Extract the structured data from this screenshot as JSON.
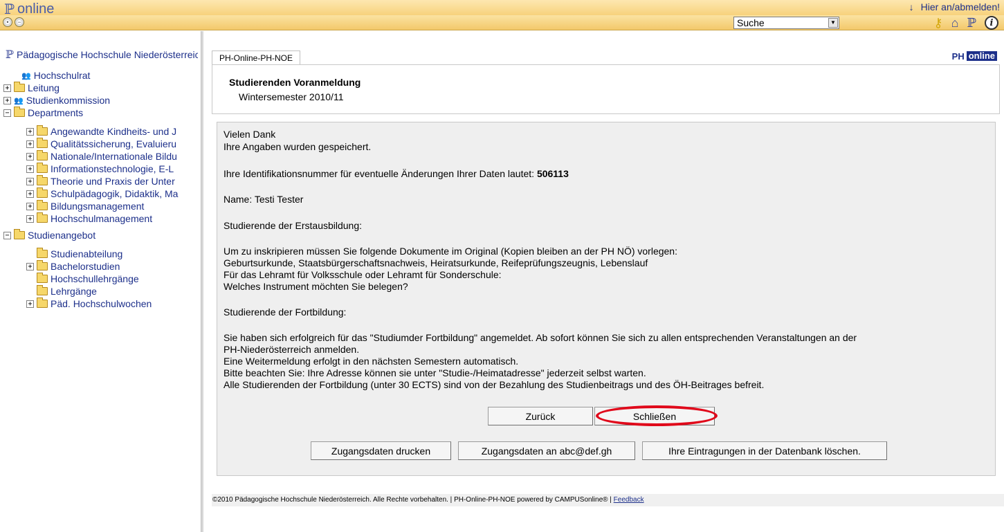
{
  "header": {
    "brand_text": "online",
    "login_text": "Hier an/abmelden!",
    "search_value": "Suche"
  },
  "toolbar": {
    "icons": [
      "back-icon",
      "forward-icon",
      "key-icon",
      "home-icon",
      "ph-icon",
      "info-icon"
    ]
  },
  "sidebar": {
    "root_label": "Pädagogische Hochschule Niederösterreich",
    "items": [
      {
        "label": "Hochschulrat",
        "icon": "people-icon",
        "expander": ""
      },
      {
        "label": "Leitung",
        "icon": "folder-icon",
        "expander": "+"
      },
      {
        "label": "Studienkommission",
        "icon": "people-icon",
        "expander": "+"
      },
      {
        "label": "Departments",
        "icon": "folder-icon",
        "expander": "−"
      },
      {
        "label": "Angewandte Kindheits- und J",
        "icon": "folder-icon",
        "expander": "+"
      },
      {
        "label": "Qualitätssicherung, Evaluieru",
        "icon": "folder-icon",
        "expander": "+"
      },
      {
        "label": "Nationale/Internationale Bildu",
        "icon": "folder-icon",
        "expander": "+"
      },
      {
        "label": "Informationstechnologie, E-L",
        "icon": "folder-icon",
        "expander": "+"
      },
      {
        "label": "Theorie und Praxis der Unter",
        "icon": "folder-icon",
        "expander": "+"
      },
      {
        "label": "Schulpädagogik, Didaktik, Ma",
        "icon": "folder-icon",
        "expander": "+"
      },
      {
        "label": "Bildungsmanagement",
        "icon": "folder-icon",
        "expander": "+"
      },
      {
        "label": "Hochschulmanagement",
        "icon": "folder-icon",
        "expander": "+"
      },
      {
        "label": "Studienangebot",
        "icon": "folder-icon",
        "expander": "−"
      },
      {
        "label": "Studienabteilung",
        "icon": "folder-icon",
        "expander": ""
      },
      {
        "label": "Bachelorstudien",
        "icon": "folder-icon",
        "expander": "+"
      },
      {
        "label": "Hochschullehrgänge",
        "icon": "folder-icon",
        "expander": ""
      },
      {
        "label": "Lehrgänge",
        "icon": "folder-icon",
        "expander": ""
      },
      {
        "label": "Päd. Hochschulwochen",
        "icon": "folder-icon",
        "expander": "+"
      }
    ]
  },
  "main": {
    "tab_label": "PH-Online-PH-NOE",
    "logo_ph": "PH",
    "logo_online": "online",
    "title": "Studierenden Voranmeldung",
    "subtitle": "Wintersemester 2010/11",
    "lines": {
      "l1": "Vielen Dank",
      "l2": "Ihre Angaben wurden gespeichert.",
      "l3_prefix": "Ihre Identifikationsnummer für eventuelle Änderungen Ihrer Daten lautet: ",
      "l3_id": "506113",
      "l4": "Name: Testi Tester",
      "l5": "Studierende der Erstausbildung:",
      "l6": "Um zu inskripieren müssen Sie folgende Dokumente im Original (Kopien bleiben an der PH NÖ) vorlegen:",
      "l7": "Geburtsurkunde, Staatsbürgerschaftsnachweis, Heiratsurkunde, Reifeprüfungszeugnis, Lebenslauf",
      "l8": "Für das Lehramt für Volksschule oder Lehramt für Sonderschule:",
      "l9": "Welches Instrument möchten Sie belegen?",
      "l10": "Studierende der Fortbildung:",
      "l11": "Sie haben sich erfolgreich für das \"Studiumder Fortbildung\" angemeldet. Ab sofort können Sie sich zu allen entsprechenden Veranstaltungen an der",
      "l12": "PH-Niederösterreich anmelden.",
      "l13": "Eine Weitermeldung erfolgt in den nächsten Semestern automatisch.",
      "l14": "Bitte beachten Sie: Ihre Adresse können sie unter \"Studie-/Heimatadresse\" jederzeit selbst warten.",
      "l15": "Alle Studierenden der Fortbildung (unter 30 ECTS) sind von der Bezahlung des Studienbeitrags und des ÖH-Beitrages befreit."
    },
    "buttons": {
      "back": "Zurück",
      "close": "Schließen",
      "print": "Zugangsdaten drucken",
      "send": "Zugangsdaten an abc@def.gh",
      "delete": "Ihre Eintragungen in der Datenbank löschen."
    }
  },
  "footer": {
    "text": "©2010 Pädagogische Hochschule Niederösterreich. Alle Rechte vorbehalten. | PH-Online-PH-NOE powered by CAMPUSonline® | ",
    "feedback": "Feedback"
  },
  "colors": {
    "header_gold": "#f7d27c",
    "link_blue": "#1c2f8a",
    "highlight_red": "#e0081a",
    "content_grey": "#efefef"
  }
}
